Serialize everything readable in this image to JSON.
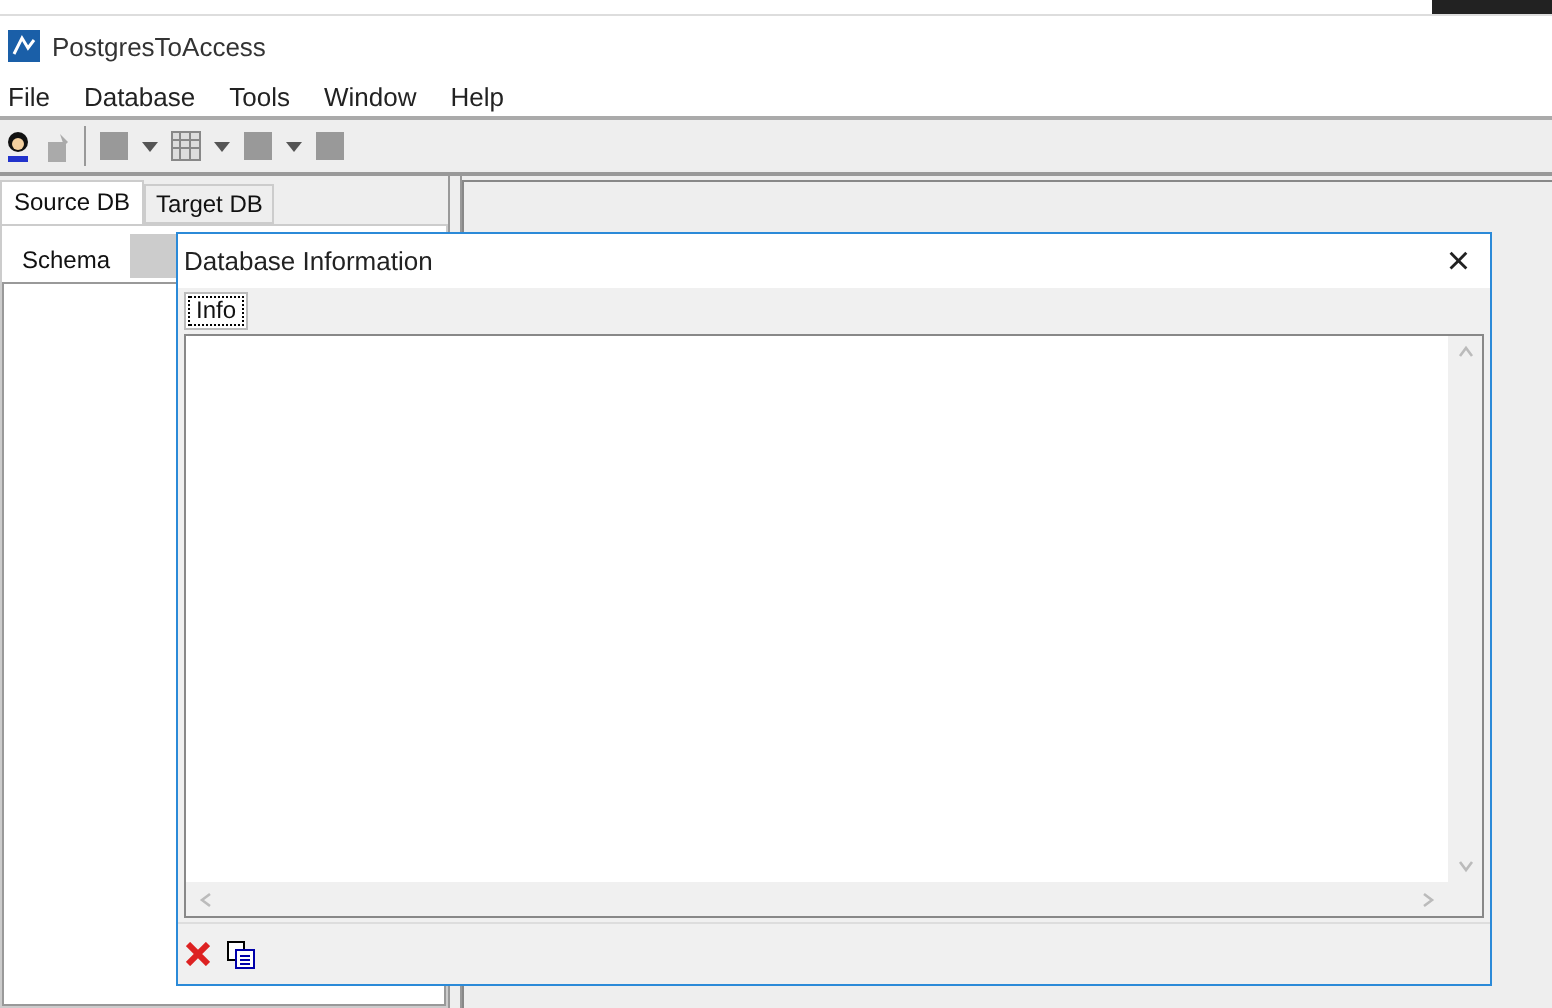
{
  "window": {
    "title": "PostgresToAccess"
  },
  "menu": [
    "File",
    "Database",
    "Tools",
    "Window",
    "Help"
  ],
  "side_tabs": [
    {
      "label": "Source DB",
      "selected": true
    },
    {
      "label": "Target DB",
      "selected": false
    }
  ],
  "schema_label": "Schema",
  "dialog": {
    "title": "Database Information",
    "close": "×",
    "tabs": [
      {
        "label": "Info",
        "selected": true
      }
    ]
  }
}
